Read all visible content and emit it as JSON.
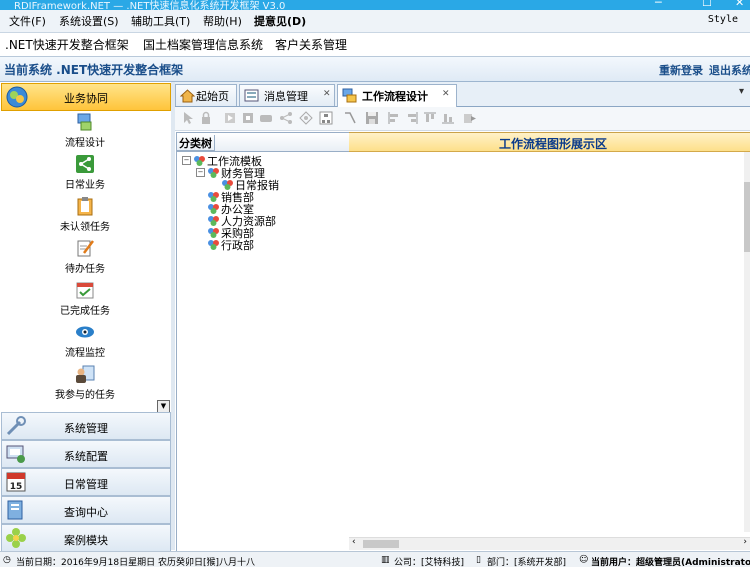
{
  "window": {
    "title": "RDIFramework.NET — .NET快速信息化系统开发框架 V3.0",
    "minimize": "─",
    "maximize": "☐",
    "close": "✕"
  },
  "menubar": {
    "items": [
      "文件(F)",
      "系统设置(S)",
      "辅助工具(T)",
      "帮助(H)",
      "提意见(D)"
    ],
    "style_label": "Style"
  },
  "systems": [
    ".NET快速开发整合框架",
    "国土档案管理信息系统",
    "客户关系管理"
  ],
  "current_system": {
    "label": "当前系统 .NET快速开发整合框架",
    "relogin": "重新登录",
    "logout": "退出系统"
  },
  "left_nav": {
    "header": "业务协同",
    "items": [
      {
        "label": "流程设计",
        "icon": "flow-design-icon"
      },
      {
        "label": "日常业务",
        "icon": "share-icon"
      },
      {
        "label": "未认领任务",
        "icon": "clipboard-icon"
      },
      {
        "label": "待办任务",
        "icon": "edit-doc-icon"
      },
      {
        "label": "已完成任务",
        "icon": "calendar-check-icon"
      },
      {
        "label": "流程监控",
        "icon": "eye-icon"
      },
      {
        "label": "我参与的任务",
        "icon": "person-doc-icon"
      }
    ],
    "modules": [
      {
        "label": "系统管理",
        "icon": "tools-icon"
      },
      {
        "label": "系统配置",
        "icon": "config-icon"
      },
      {
        "label": "日常管理",
        "icon": "calendar-15-icon"
      },
      {
        "label": "查询中心",
        "icon": "query-icon"
      },
      {
        "label": "案例模块",
        "icon": "flower-icon"
      }
    ]
  },
  "tabs": [
    {
      "label": "起始页",
      "closable": false,
      "active": false
    },
    {
      "label": "消息管理",
      "closable": true,
      "active": false
    },
    {
      "label": "工作流程设计",
      "closable": true,
      "active": true
    }
  ],
  "tab_overflow": "▾",
  "tree": {
    "header": "分类树",
    "nodes": [
      {
        "label": "工作流模板",
        "level": 0
      },
      {
        "label": "财务管理",
        "level": 1
      },
      {
        "label": "日常报销",
        "level": 2
      },
      {
        "label": "销售部",
        "level": 1
      },
      {
        "label": "办公室",
        "level": 1
      },
      {
        "label": "人力资源部",
        "level": 1
      },
      {
        "label": "采购部",
        "level": 1
      },
      {
        "label": "行政部",
        "level": 1
      }
    ]
  },
  "flow_area": {
    "title": "工作流程图形展示区"
  },
  "statusbar": {
    "date": "当前日期：2016年9月18日星期日  农历癸卯日[猴]八月十八",
    "company": "公司：[艾特科技]",
    "dept": "部门：[系统开发部]",
    "user": "当前用户：超级管理员(Administrator)"
  },
  "colors": {
    "accent": "#ffc43a",
    "title_blue": "#1a4e8a",
    "titlebar": "#2aa8e6"
  }
}
